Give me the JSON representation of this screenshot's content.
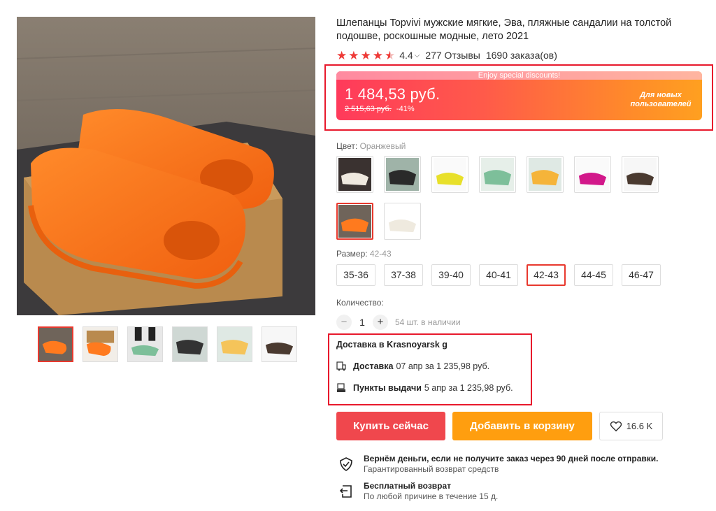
{
  "product": {
    "title": "Шлепанцы Topvivi мужские мягкие, Эва, пляжные сандалии на толстой подошве, роскошные модные, лето 2021",
    "rating": "4.4",
    "reviews": "277 Отзывы",
    "orders": "1690 заказа(ов)",
    "star_count": 4.5
  },
  "price": {
    "banner_top": "Enjoy special discounts!",
    "current": "1 484,53 руб.",
    "old": "2 515,63 руб.",
    "discount": "-41%",
    "promo": "Для новых пользователей"
  },
  "color": {
    "label": "Цвет:",
    "selected": "Оранжевый",
    "options": [
      "white",
      "black",
      "yellow",
      "mint",
      "orange-yellow",
      "magenta",
      "brown",
      "orange",
      "cream"
    ]
  },
  "size": {
    "label": "Размер:",
    "selected": "42-43",
    "options": [
      "35-36",
      "37-38",
      "39-40",
      "40-41",
      "42-43",
      "44-45",
      "46-47"
    ]
  },
  "quantity": {
    "label": "Количество:",
    "minus": "−",
    "value": "1",
    "plus": "+",
    "stock": "54 шт. в наличии"
  },
  "delivery": {
    "title": "Доставка в Krasnoyarsk g",
    "rows": [
      {
        "name": "Доставка",
        "detail": "07 апр за 1 235,98 руб.",
        "icon": "truck-icon"
      },
      {
        "name": "Пункты выдачи",
        "detail": "5 апр за 1 235,98 руб.",
        "icon": "pickup-point-icon"
      }
    ]
  },
  "actions": {
    "buy": "Купить сейчас",
    "cart": "Добавить в корзину",
    "wishlist_count": "16.6 K"
  },
  "guarantees": [
    {
      "title": "Вернём деньги, если не получите заказ через 90 дней после отправки.",
      "subtitle": "Гарантированный возврат средств",
      "icon": "shield-check-icon"
    },
    {
      "title": "Бесплатный возврат",
      "subtitle": "По любой причине в течение 15 д.",
      "icon": "return-icon"
    }
  ],
  "colors": {
    "accent_red": "#e8392e",
    "buy_button": "#f0474d",
    "cart_button": "#ff9e0f",
    "star": "#ee3a37"
  }
}
